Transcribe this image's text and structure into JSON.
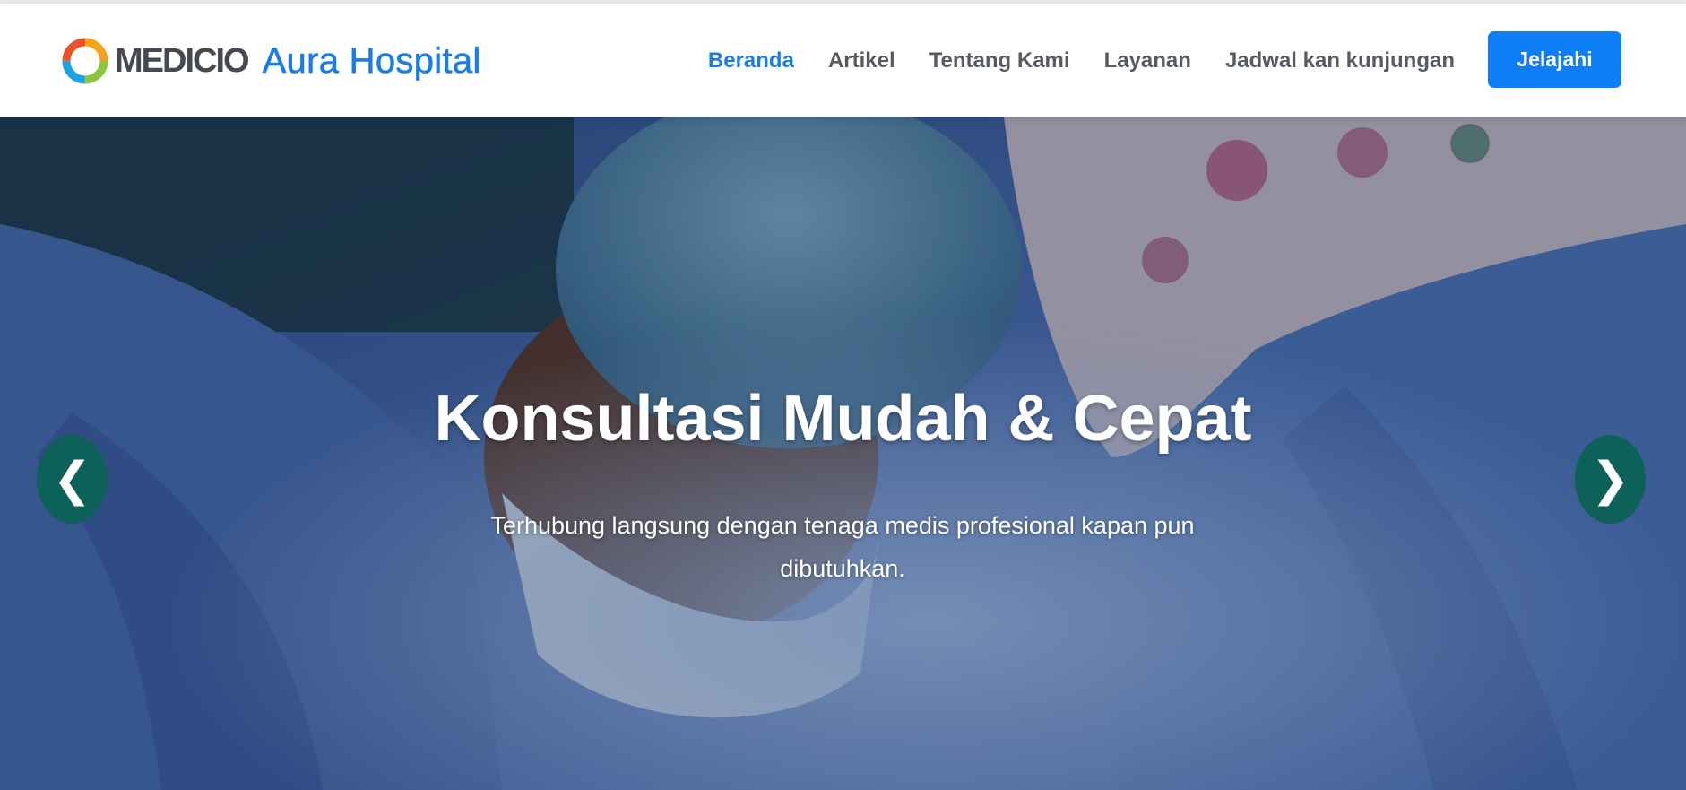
{
  "header": {
    "logo_text": "MEDICIO",
    "site_name": "Aura Hospital",
    "cta_label": "Jelajahi"
  },
  "nav": {
    "items": [
      {
        "label": "Beranda",
        "active": true
      },
      {
        "label": "Artikel",
        "active": false
      },
      {
        "label": "Tentang Kami",
        "active": false
      },
      {
        "label": "Layanan",
        "active": false
      },
      {
        "label": "Jadwal kan kunjungan",
        "active": false
      }
    ]
  },
  "hero": {
    "title": "Konsultasi Mudah & Cepat",
    "subtitle": "Terhubung langsung dengan tenaga medis profesional kapan pun dibutuhkan.",
    "prev_icon": "chevron-left-icon",
    "next_icon": "chevron-right-icon",
    "prev_glyph": "❮",
    "next_glyph": "❯"
  },
  "colors": {
    "brand_blue": "#1b7ce8",
    "cta_blue": "#0d7ef5",
    "nav_text": "#555b61",
    "arrow_teal": "#0d6158"
  }
}
